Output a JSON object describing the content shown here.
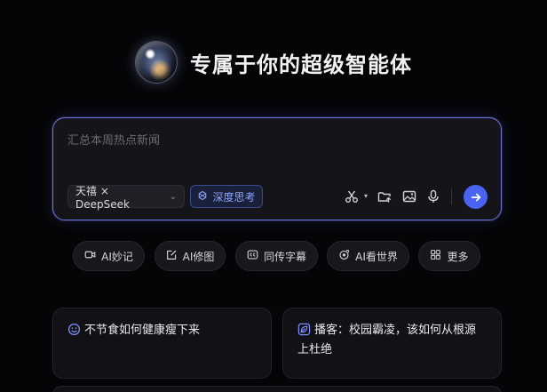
{
  "header": {
    "title": "专属于你的超级智能体",
    "logo": "orb-logo-icon"
  },
  "composer": {
    "placeholder": "汇总本周热点新闻",
    "value": "",
    "model_label": "天禧 × DeepSeek",
    "deep_think_label": "深度思考",
    "tools": [
      "scissors-icon",
      "folder-upload-icon",
      "image-icon",
      "microphone-icon"
    ],
    "send_icon": "arrow-right-icon"
  },
  "chips": [
    {
      "label": "AI妙记",
      "icon": "video-icon"
    },
    {
      "label": "AI修图",
      "icon": "edit-image-icon"
    },
    {
      "label": "同传字幕",
      "icon": "caption-icon"
    },
    {
      "label": "AI看世界",
      "icon": "eye-camera-icon"
    },
    {
      "label": "更多",
      "icon": "grid-icon"
    }
  ],
  "cards": [
    {
      "text": "不节食如何健康瘦下来",
      "icon": "smiley-icon"
    },
    {
      "text": "播客：校园霸凌，该如何从根源上杜绝",
      "icon": "leaf-icon"
    }
  ],
  "colors": {
    "accent": "#4a63f0",
    "border_glow": "#6f74d8",
    "background": "#050507",
    "card_bg": "#121216"
  }
}
